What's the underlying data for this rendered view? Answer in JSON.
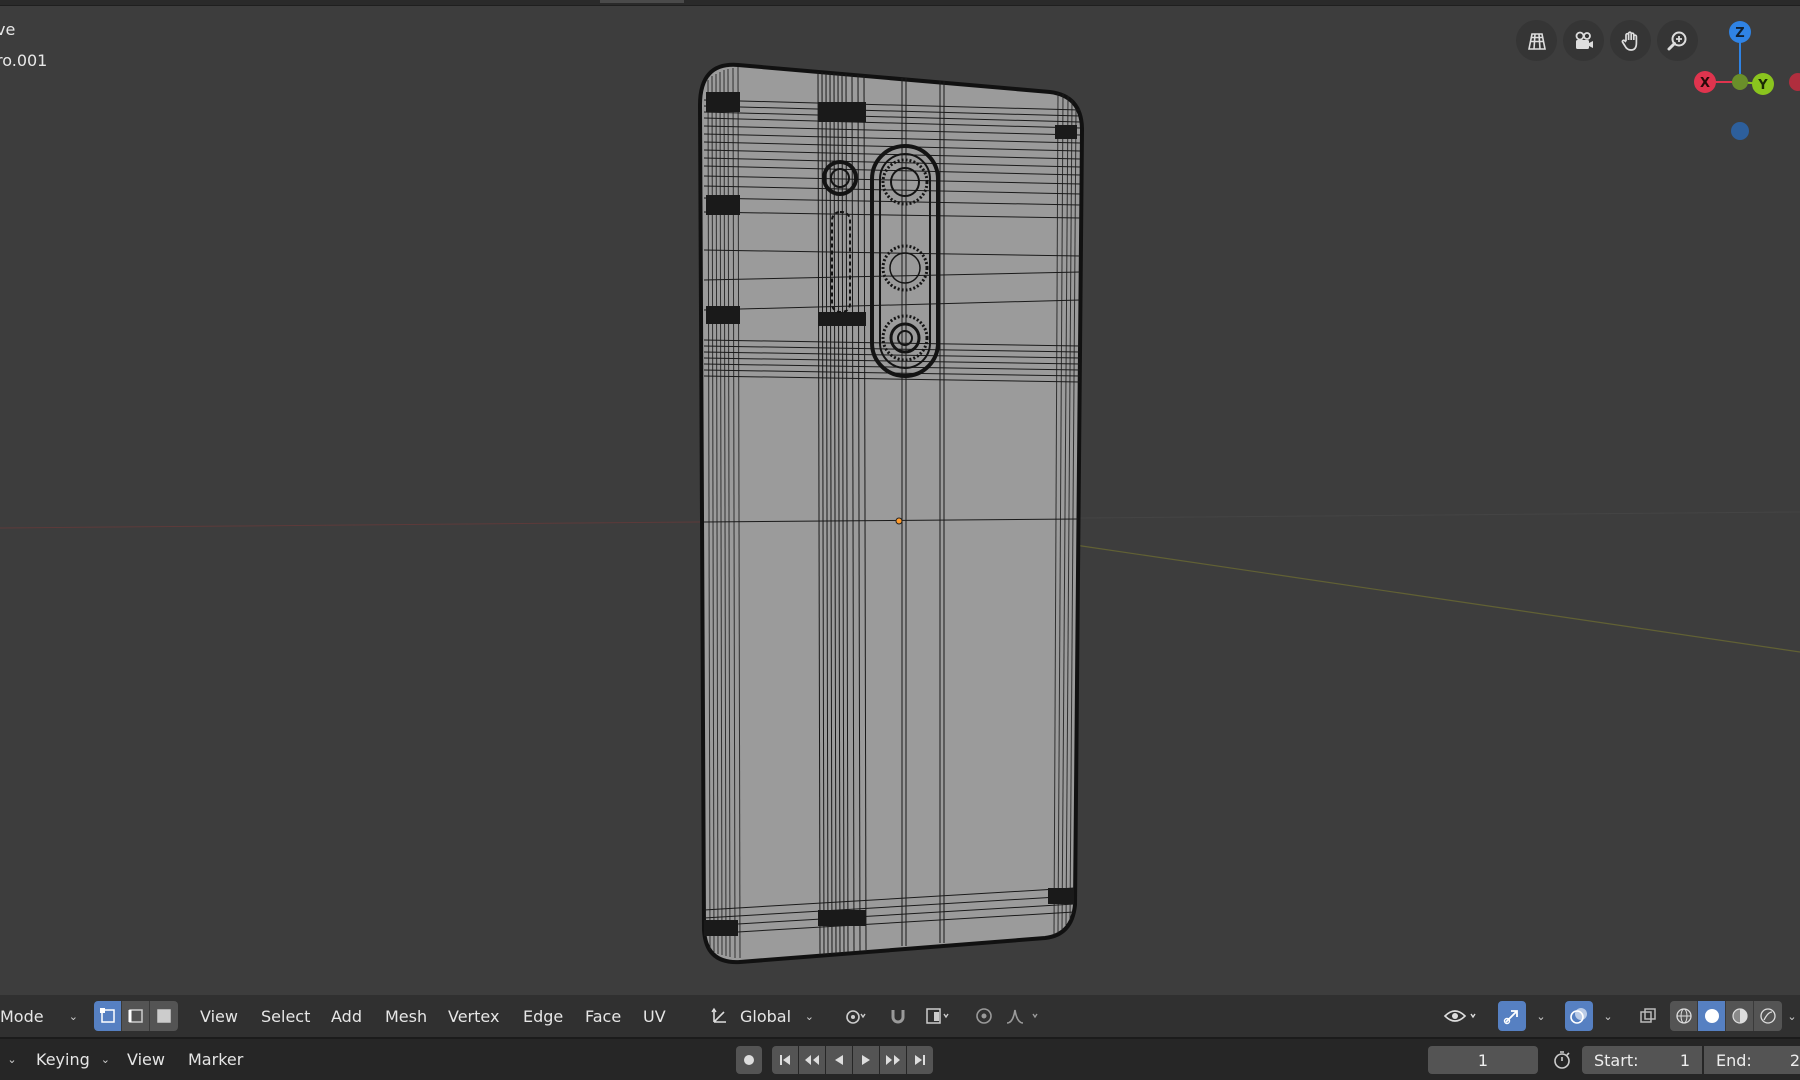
{
  "viewport": {
    "overlay_line1": "ve",
    "overlay_line2": "ro.001",
    "nav_buttons": [
      {
        "icon": "grid-icon"
      },
      {
        "icon": "camera-icon"
      },
      {
        "icon": "hand-pan-icon"
      },
      {
        "icon": "zoom-icon"
      }
    ],
    "gizmo": {
      "x_label": "X",
      "y_label": "Y",
      "z_label": "Z",
      "x_color": "#e0344e",
      "y_color": "#8ac41e",
      "z_color": "#2f83e4"
    }
  },
  "header": {
    "mode_label": "Mode",
    "select_modes": [
      "vertex-select-icon",
      "edge-select-icon",
      "face-select-icon"
    ],
    "menus": [
      "View",
      "Select",
      "Add",
      "Mesh",
      "Vertex",
      "Edge",
      "Face",
      "UV"
    ],
    "orientation": "Global",
    "right_icons": [
      "visibility-icon",
      "gizmo-toggle-icon",
      "overlay-icon",
      "xray-icon",
      "wireframe-shading-icon",
      "solid-shading-icon",
      "material-shading-icon",
      "rendered-shading-icon"
    ]
  },
  "timeline": {
    "keying_label": "Keying",
    "menus": [
      "View",
      "Marker"
    ],
    "current_frame": "1",
    "start_label": "Start:",
    "start_value": "1",
    "end_label": "End:",
    "end_value": "2"
  },
  "colors": {
    "accent": "#5680c2",
    "viewport_bg": "#3d3d3d",
    "header_bg": "#303030",
    "mesh_fill": "#9b9b9b"
  }
}
